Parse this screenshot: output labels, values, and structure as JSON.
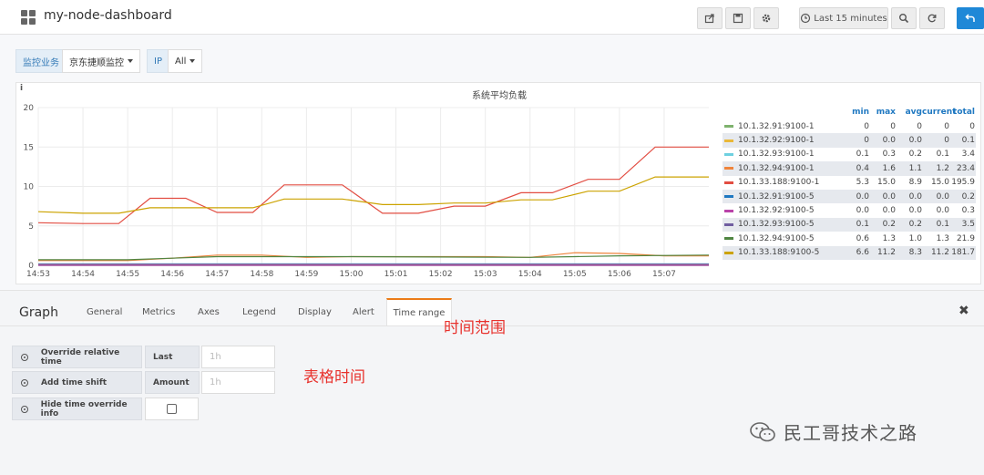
{
  "navbar": {
    "title": "my-node-dashboard",
    "time_picker_label": "Last 15 minutes"
  },
  "variables": [
    {
      "label": "监控业务",
      "value": "京东捷顺监控"
    },
    {
      "label": "IP",
      "value": "All"
    }
  ],
  "panel": {
    "info": "i",
    "title": "系统平均负载"
  },
  "chart_data": {
    "type": "line",
    "title": "系统平均负载",
    "x": [
      "14:53",
      "14:54",
      "14:55",
      "14:56",
      "14:57",
      "14:58",
      "14:59",
      "15:00",
      "15:01",
      "15:02",
      "15:03",
      "15:04",
      "15:05",
      "15:06",
      "15:07"
    ],
    "y_ticks": [
      "0",
      "5",
      "10",
      "15",
      "20"
    ],
    "ylim": [
      0,
      20
    ],
    "xlim": [
      "14:53",
      "15:08"
    ],
    "grid": true,
    "legend_placement": "right",
    "series": [
      {
        "name": "10.1.32.91:9100-1",
        "color": "#7eb26d",
        "min": "0",
        "max": "0",
        "avg": "0",
        "current": "0",
        "total": "0",
        "points": [
          [
            "14:53",
            0
          ],
          [
            "15:08",
            0
          ]
        ]
      },
      {
        "name": "10.1.32.92:9100-1",
        "color": "#eab839",
        "min": "0",
        "max": "0.0",
        "avg": "0.0",
        "current": "0",
        "total": "0.1",
        "points": [
          [
            "14:53",
            0.05
          ],
          [
            "15:08",
            0.05
          ]
        ]
      },
      {
        "name": "10.1.32.93:9100-1",
        "color": "#6ed0e0",
        "min": "0.1",
        "max": "0.3",
        "avg": "0.2",
        "current": "0.1",
        "total": "3.4",
        "points": [
          [
            "14:53",
            0.2
          ],
          [
            "15:08",
            0.2
          ]
        ]
      },
      {
        "name": "10.1.32.94:9100-1",
        "color": "#ef843c",
        "min": "0.4",
        "max": "1.6",
        "avg": "1.1",
        "current": "1.2",
        "total": "23.4",
        "points": [
          [
            "14:53",
            0.6
          ],
          [
            "14:55",
            0.6
          ],
          [
            "14:56",
            0.9
          ],
          [
            "14:57",
            1.3
          ],
          [
            "14:58",
            1.3
          ],
          [
            "14:59",
            1.0
          ],
          [
            "15:00",
            1.1
          ],
          [
            "15:03",
            1.1
          ],
          [
            "15:04",
            1.0
          ],
          [
            "15:05",
            1.6
          ],
          [
            "15:06",
            1.5
          ],
          [
            "15:07",
            1.2
          ],
          [
            "15:08",
            1.2
          ]
        ]
      },
      {
        "name": "10.1.33.188:9100-1",
        "color": "#e24d42",
        "min": "5.3",
        "max": "15.0",
        "avg": "8.9",
        "current": "15.0",
        "total": "195.9",
        "points": [
          [
            "14:53",
            5.4
          ],
          [
            "14:54",
            5.3
          ],
          [
            "14:54.8",
            5.3
          ],
          [
            "14:55.5",
            8.5
          ],
          [
            "14:56.3",
            8.5
          ],
          [
            "14:57",
            6.7
          ],
          [
            "14:57.8",
            6.7
          ],
          [
            "14:58.5",
            10.2
          ],
          [
            "14:59.8",
            10.2
          ],
          [
            "15:00.7",
            6.6
          ],
          [
            "15:01.5",
            6.6
          ],
          [
            "15:02.3",
            7.5
          ],
          [
            "15:03",
            7.5
          ],
          [
            "15:03.8",
            9.2
          ],
          [
            "15:04.5",
            9.2
          ],
          [
            "15:05.3",
            10.9
          ],
          [
            "15:06",
            10.9
          ],
          [
            "15:06.8",
            15.0
          ],
          [
            "15:08",
            15.0
          ]
        ]
      },
      {
        "name": "10.1.32.91:9100-5",
        "color": "#1f78c1",
        "min": "0.0",
        "max": "0.0",
        "avg": "0.0",
        "current": "0.0",
        "total": "0.2",
        "points": [
          [
            "14:53",
            0.0
          ],
          [
            "15:08",
            0.0
          ]
        ]
      },
      {
        "name": "10.1.32.92:9100-5",
        "color": "#ba43a9",
        "min": "0.0",
        "max": "0.0",
        "avg": "0.0",
        "current": "0.0",
        "total": "0.3",
        "points": [
          [
            "14:53",
            0.0
          ],
          [
            "15:08",
            0.0
          ]
        ]
      },
      {
        "name": "10.1.32.93:9100-5",
        "color": "#705da0",
        "min": "0.1",
        "max": "0.2",
        "avg": "0.2",
        "current": "0.1",
        "total": "3.5",
        "points": [
          [
            "14:53",
            0.15
          ],
          [
            "15:08",
            0.15
          ]
        ]
      },
      {
        "name": "10.1.32.94:9100-5",
        "color": "#508642",
        "min": "0.6",
        "max": "1.3",
        "avg": "1.0",
        "current": "1.3",
        "total": "21.9",
        "points": [
          [
            "14:53",
            0.7
          ],
          [
            "14:55",
            0.7
          ],
          [
            "14:56",
            0.9
          ],
          [
            "14:57",
            1.1
          ],
          [
            "14:59",
            1.1
          ],
          [
            "15:00",
            1.1
          ],
          [
            "15:04",
            1.0
          ],
          [
            "15:05",
            1.1
          ],
          [
            "15:06",
            1.2
          ],
          [
            "15:08",
            1.3
          ]
        ]
      },
      {
        "name": "10.1.33.188:9100-5",
        "color": "#cca300",
        "min": "6.6",
        "max": "11.2",
        "avg": "8.3",
        "current": "11.2",
        "total": "181.7",
        "points": [
          [
            "14:53",
            6.8
          ],
          [
            "14:54",
            6.6
          ],
          [
            "14:54.8",
            6.6
          ],
          [
            "14:55.5",
            7.3
          ],
          [
            "14:56.3",
            7.3
          ],
          [
            "14:57.8",
            7.3
          ],
          [
            "14:58.5",
            8.4
          ],
          [
            "14:59.8",
            8.4
          ],
          [
            "15:00.7",
            7.7
          ],
          [
            "15:01.5",
            7.7
          ],
          [
            "15:02.3",
            7.9
          ],
          [
            "15:03",
            7.9
          ],
          [
            "15:03.8",
            8.3
          ],
          [
            "15:04.5",
            8.3
          ],
          [
            "15:05.3",
            9.4
          ],
          [
            "15:06",
            9.4
          ],
          [
            "15:06.8",
            11.2
          ],
          [
            "15:08",
            11.2
          ]
        ]
      }
    ]
  },
  "legend": {
    "headers": [
      "min",
      "max",
      "avg",
      "current",
      "total"
    ]
  },
  "editor": {
    "title": "Graph",
    "tabs": [
      "General",
      "Metrics",
      "Axes",
      "Legend",
      "Display",
      "Alert"
    ],
    "active_tab": "Time range",
    "close": "✖",
    "rows": {
      "override_label": "Override relative time",
      "override_sub": "Last",
      "override_placeholder": "1h",
      "shift_label": "Add time shift",
      "shift_sub": "Amount",
      "shift_placeholder": "1h",
      "hide_label": "Hide time override info"
    }
  },
  "annotations": {
    "time_range": "时间范围",
    "table_time": "表格时间"
  },
  "watermark": {
    "text": "民工哥技术之路"
  }
}
